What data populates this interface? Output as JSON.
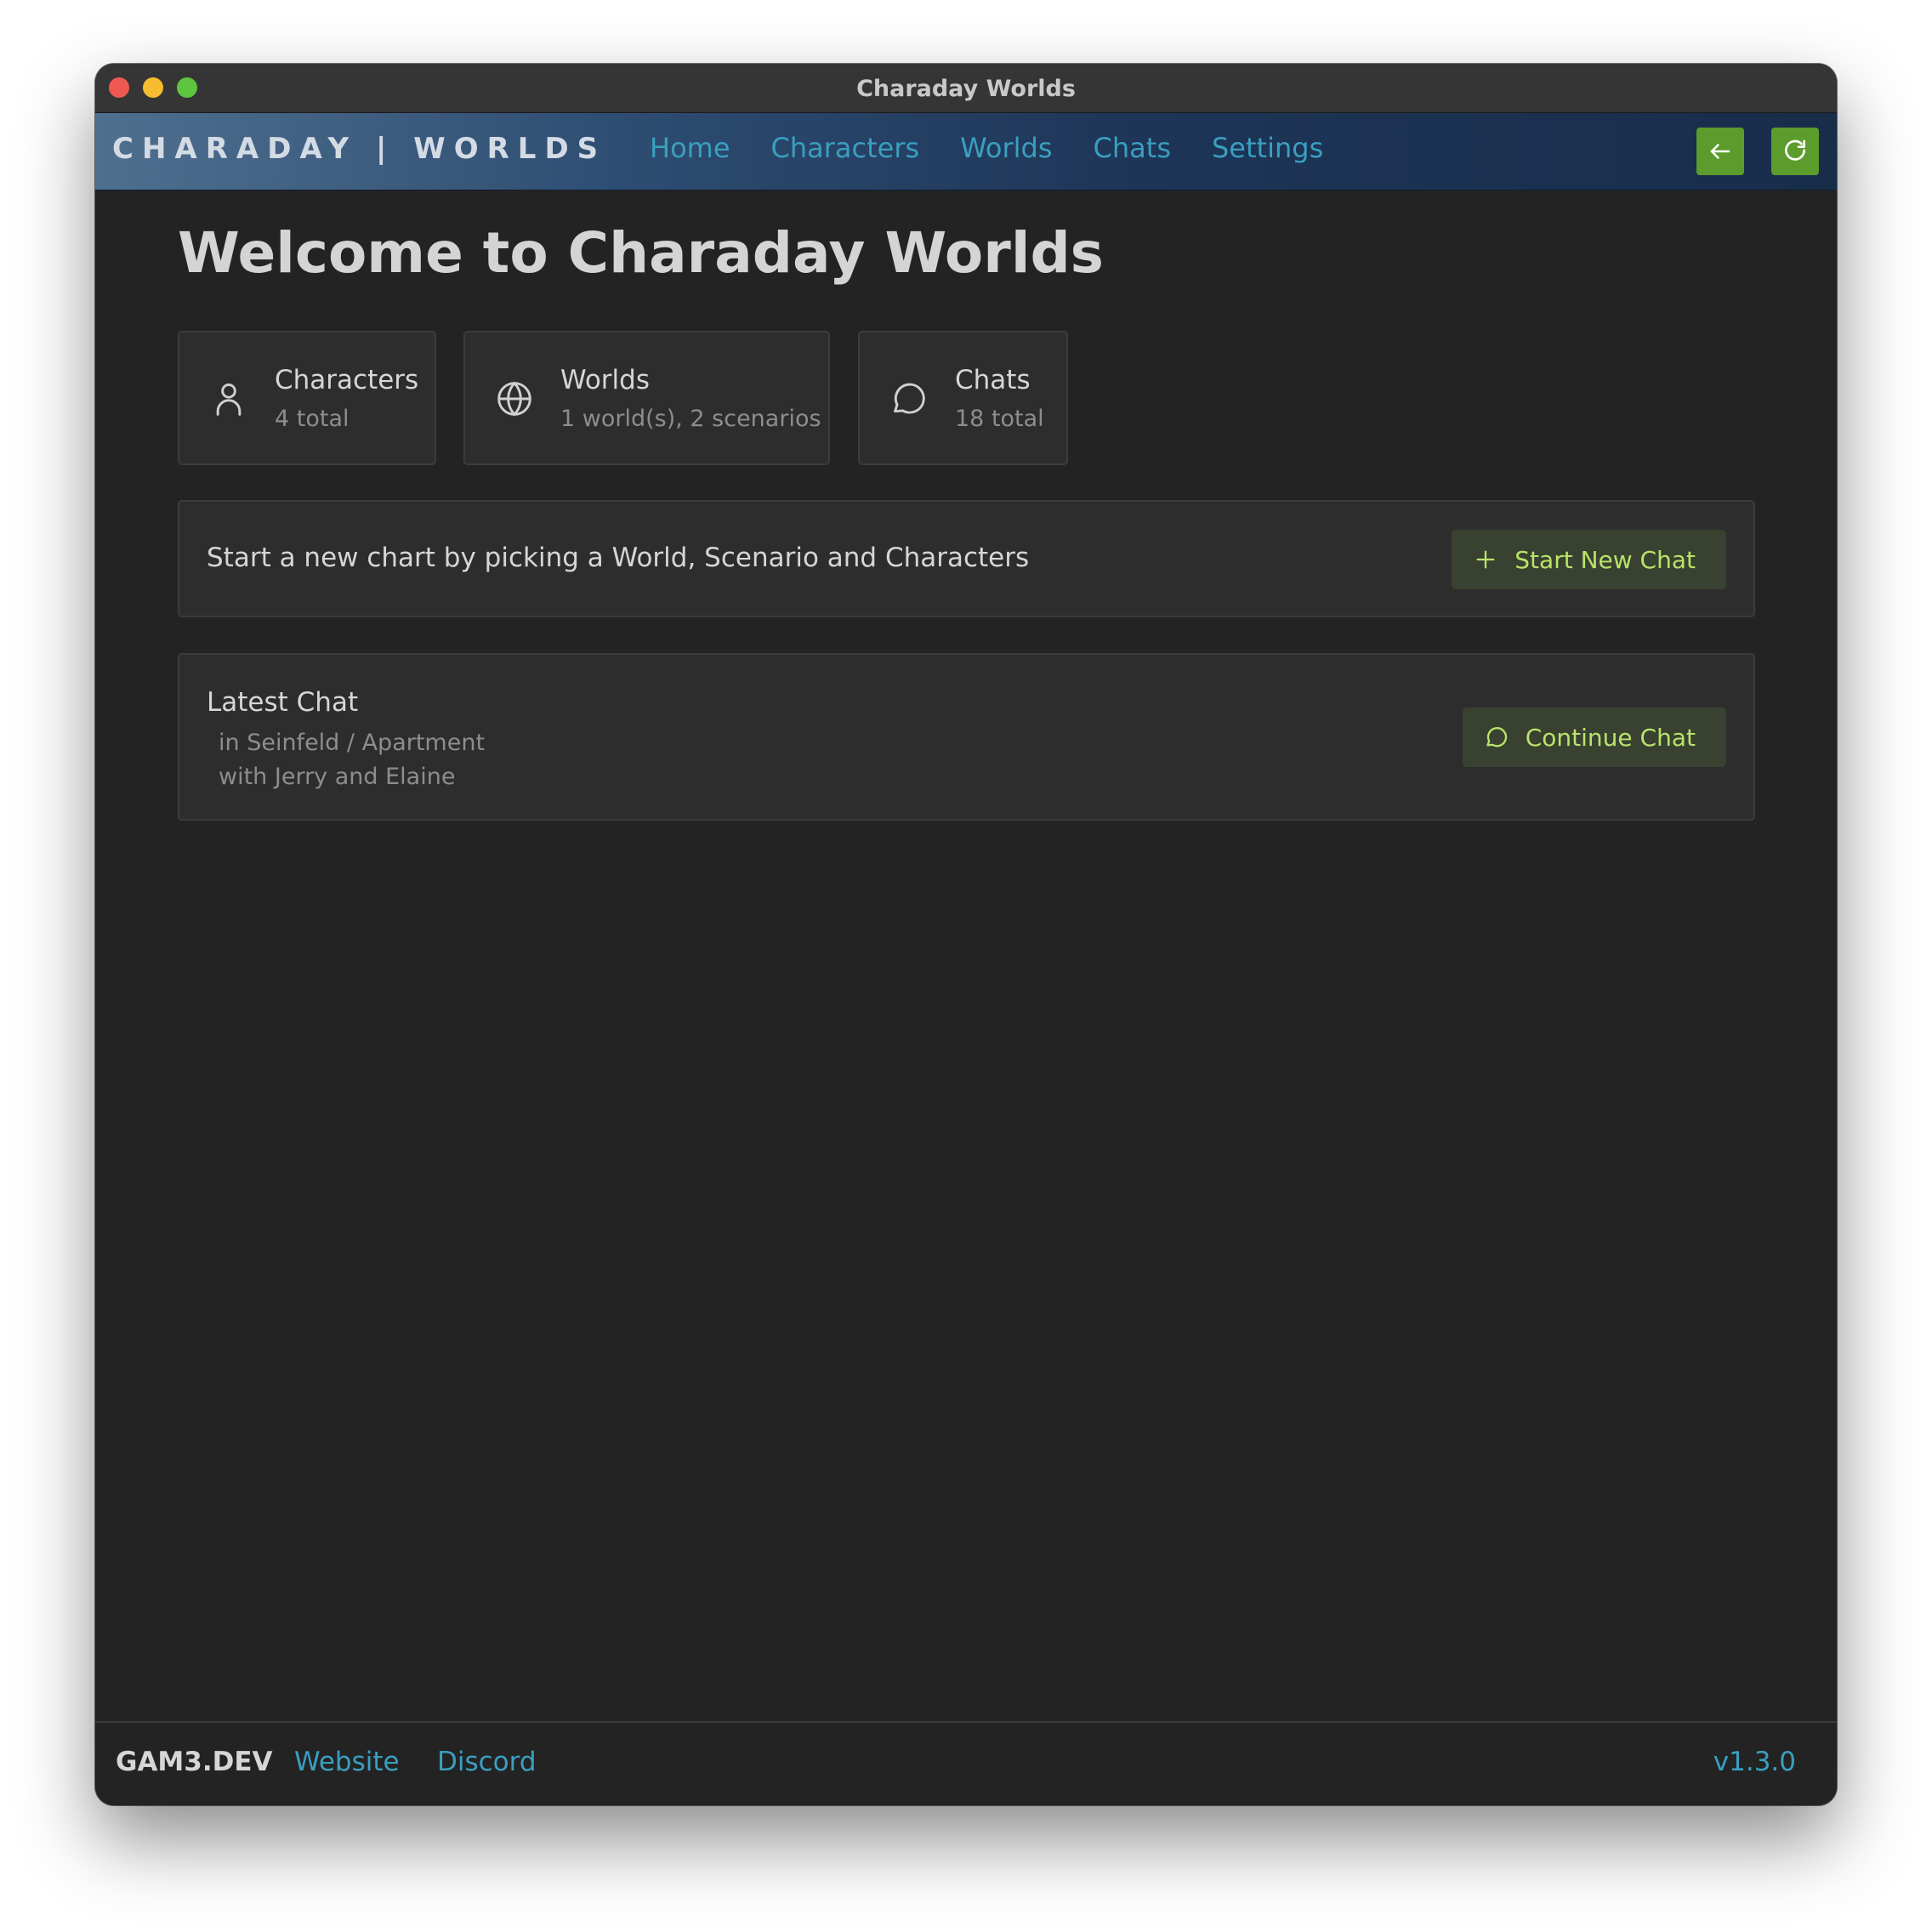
{
  "window": {
    "title": "Charaday Worlds"
  },
  "nav": {
    "brand": "CHARADAY | WORLDS",
    "links": [
      {
        "label": "Home"
      },
      {
        "label": "Characters"
      },
      {
        "label": "Worlds"
      },
      {
        "label": "Chats"
      },
      {
        "label": "Settings"
      }
    ],
    "back_icon": "arrow-left-icon",
    "refresh_icon": "refresh-icon"
  },
  "main": {
    "title": "Welcome to Charaday Worlds",
    "stats": [
      {
        "icon": "user-icon",
        "label": "Characters",
        "sub": "4 total"
      },
      {
        "icon": "globe-icon",
        "label": "Worlds",
        "sub": "1 world(s), 2 scenarios"
      },
      {
        "icon": "chat-bubble-icon",
        "label": "Chats",
        "sub": "18 total"
      }
    ],
    "new_chat": {
      "text": "Start a new chart by picking a World, Scenario and Characters",
      "button": "Start New Chat"
    },
    "latest_chat": {
      "title": "Latest Chat",
      "world": "in Seinfeld / Apartment",
      "with": "with Jerry and Elaine",
      "button": "Continue Chat"
    }
  },
  "footer": {
    "brand": "GAM3.DEV",
    "links": [
      {
        "label": "Website"
      },
      {
        "label": "Discord"
      }
    ],
    "version": "v1.3.0"
  },
  "colors": {
    "accent_green": "#5c9c2c",
    "link_blue": "#3a9fbf",
    "button_text_green": "#b9e36a",
    "background": "#232323",
    "card": "#2d2d2d"
  }
}
